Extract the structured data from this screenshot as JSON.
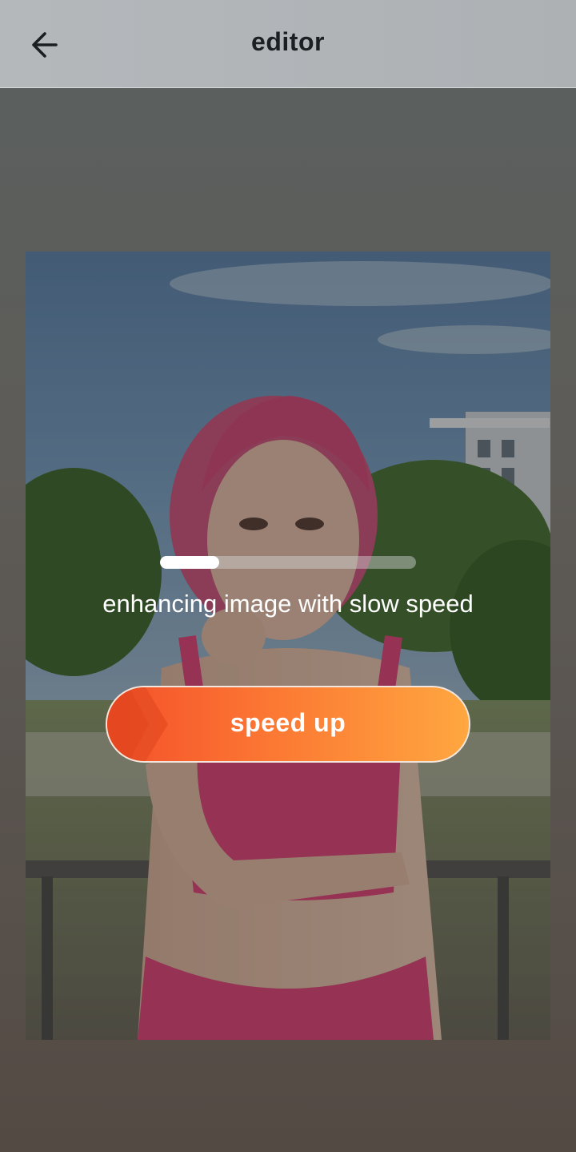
{
  "header": {
    "title": "editor",
    "back_icon": "arrow-left-icon"
  },
  "progress": {
    "fraction": 0.23,
    "status_text": "enhancing image with slow speed"
  },
  "speed_button": {
    "label": "speed up",
    "icon": "double-chevron-right-icon"
  },
  "colors": {
    "header_bg": "#b4b8bb",
    "button_start": "#f4502a",
    "button_end": "#ffa740",
    "text_light": "#ffffff",
    "title_dark": "#1b1f22"
  }
}
